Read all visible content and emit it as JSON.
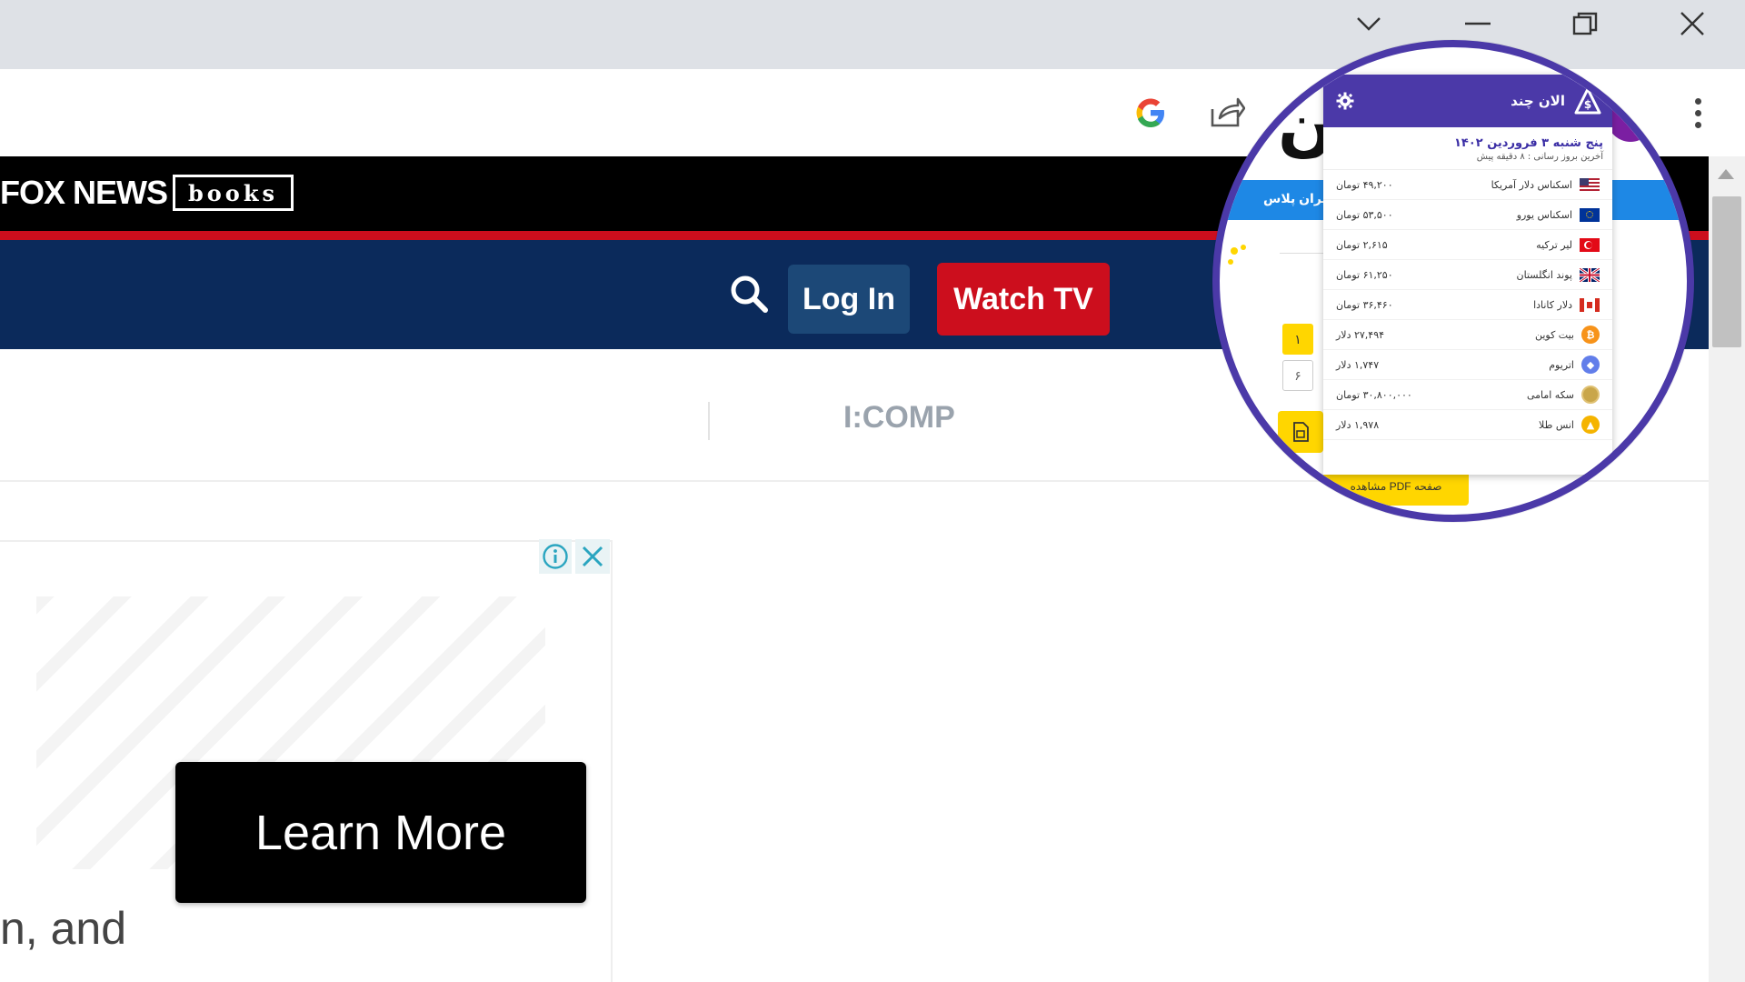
{
  "browser": {
    "window_controls": [
      "tab-search",
      "minimize",
      "restore",
      "close"
    ],
    "toolbar_icons": [
      "google-icon",
      "share-icon",
      "kebab-menu-icon"
    ]
  },
  "site": {
    "logo_text": "FOX NEWS",
    "logo_books": "books",
    "nav": {
      "login_label": "Log In",
      "watch_label": "Watch TV"
    },
    "ticker_text": "I:COMP",
    "ad": {
      "learn_more_label": "Learn More",
      "snippet_text": "n, and"
    },
    "colors": {
      "header_black": "#000000",
      "stripe_red": "#cc0e1d",
      "nav_navy": "#0b2a5b",
      "login_blue": "#1c4877",
      "watch_red": "#cc0e1d"
    }
  },
  "magnified_page": {
    "blue_bar_label": "ایران پلاس",
    "page_number_1": "۱",
    "page_number_2": "۶",
    "pdf_button_label": "مشاهده PDF صفحه"
  },
  "extension_popup": {
    "title": "الان چند",
    "date": "پنج شنبه ۳ فروردین ۱۴۰۲",
    "last_update": "آخرین بروز رسانی : ۸ دقیقه پیش",
    "accent_color": "#4b39a8",
    "rates": [
      {
        "name": "اسکناس دلار آمریکا",
        "value": "۴۹,۲۰۰ تومان",
        "icon": "us-flag"
      },
      {
        "name": "اسکناس یورو",
        "value": "۵۳,۵۰۰ تومان",
        "icon": "eu-flag"
      },
      {
        "name": "لیر ترکیه",
        "value": "۲,۶۱۵ تومان",
        "icon": "tr-flag"
      },
      {
        "name": "پوند انگلستان",
        "value": "۶۱,۲۵۰ تومان",
        "icon": "uk-flag"
      },
      {
        "name": "دلار کانادا",
        "value": "۳۶,۴۶۰ تومان",
        "icon": "ca-flag"
      },
      {
        "name": "بیت کوین",
        "value": "۲۷,۴۹۴ دلار",
        "icon": "bitcoin-icon"
      },
      {
        "name": "اتریوم",
        "value": "۱,۷۴۷ دلار",
        "icon": "ethereum-icon"
      },
      {
        "name": "سکه امامی",
        "value": "۳۰,۸۰۰,۰۰۰ تومان",
        "icon": "gold-coin-icon"
      },
      {
        "name": "انس طلا",
        "value": "۱,۹۷۸ دلار",
        "icon": "gold-ounce-icon"
      }
    ]
  }
}
